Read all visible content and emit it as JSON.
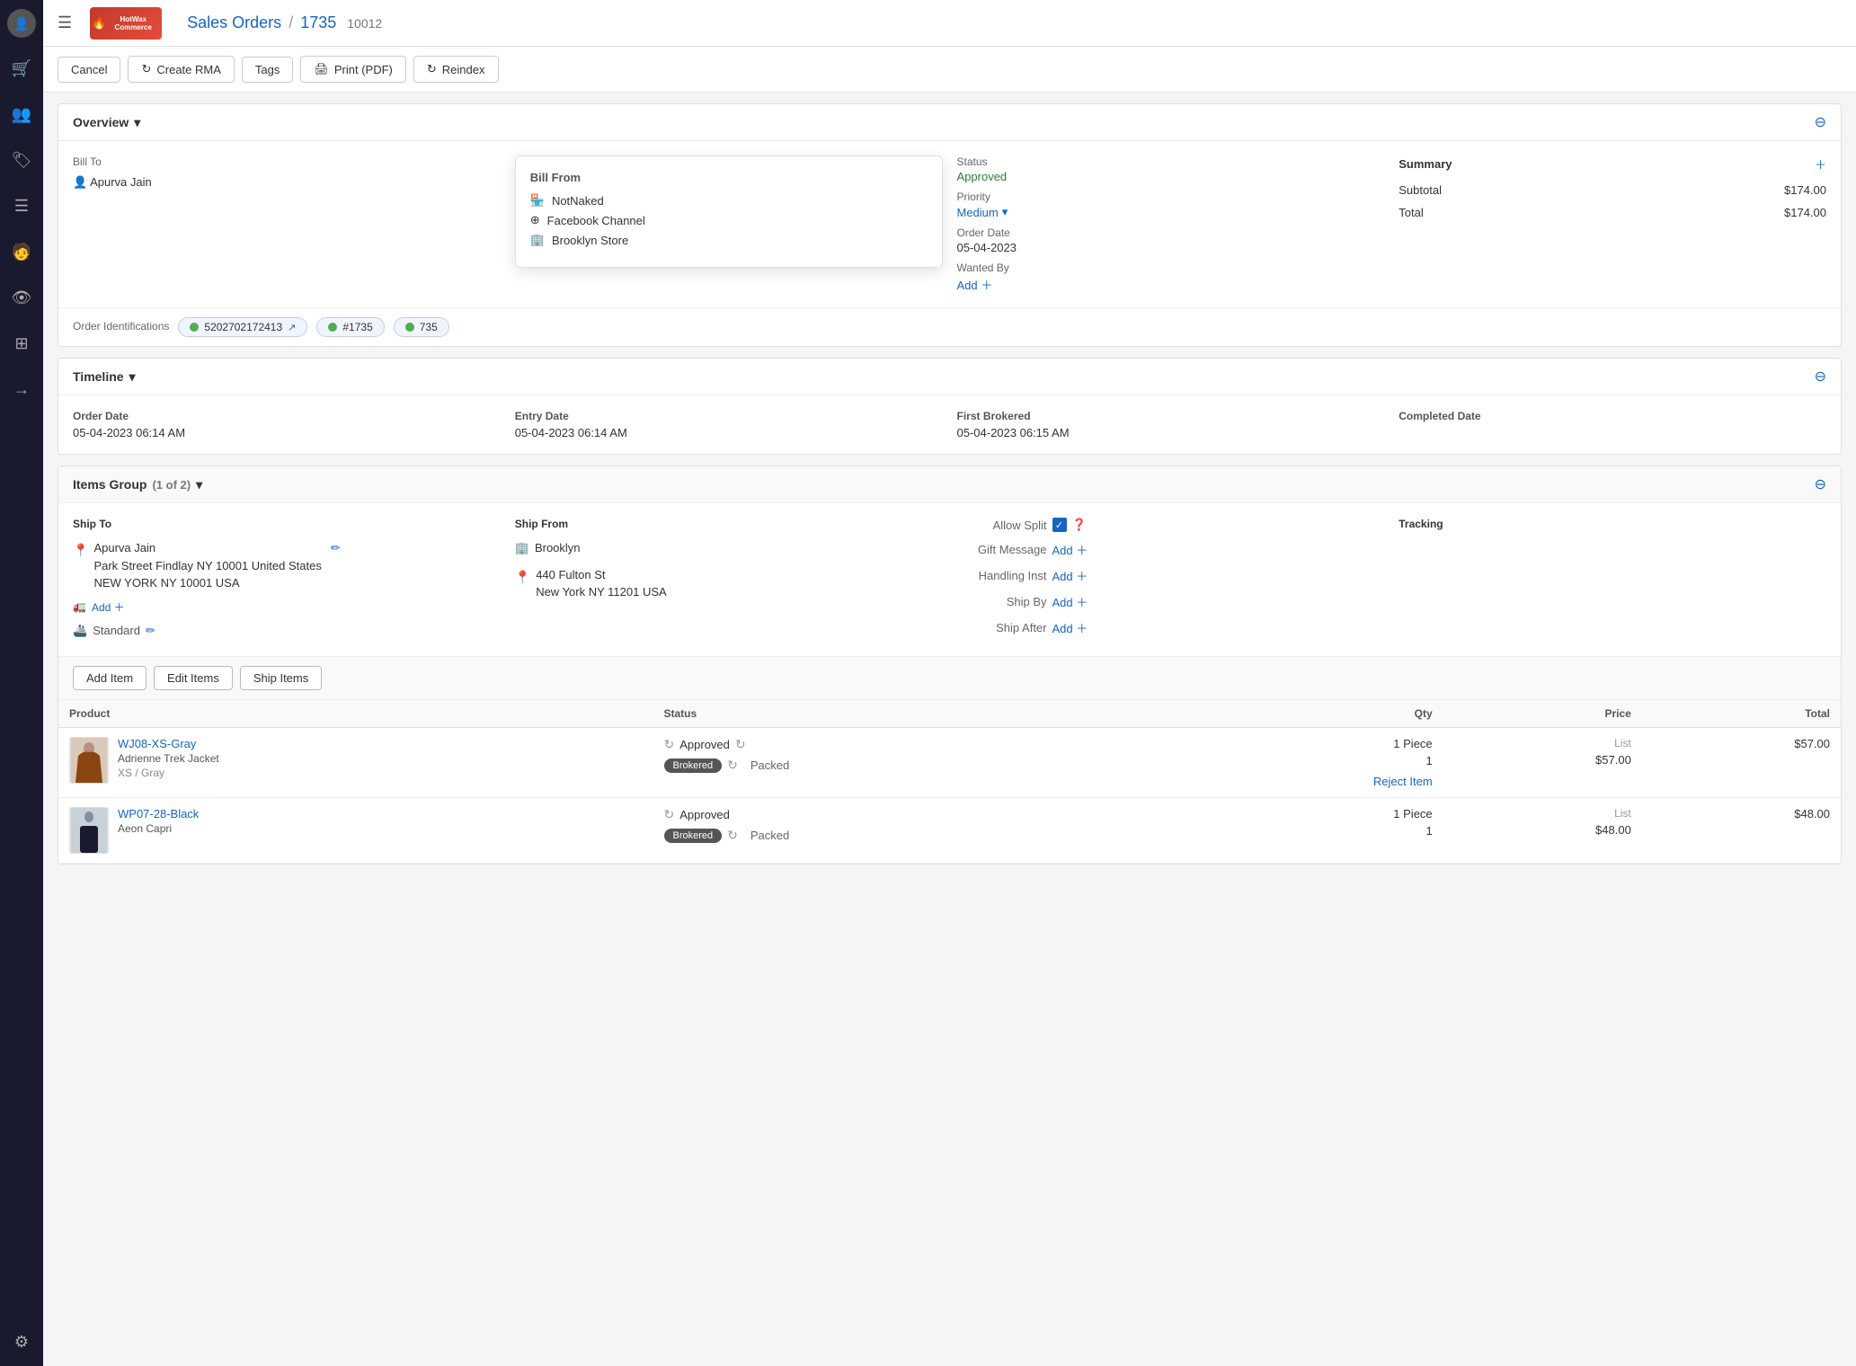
{
  "app": {
    "title": "HotWax Commerce",
    "hamburger_label": "☰"
  },
  "breadcrumb": {
    "section": "Sales Orders",
    "separator": "/",
    "order_number": "1735",
    "order_id": "10012"
  },
  "action_bar": {
    "cancel_label": "Cancel",
    "create_rma_label": "Create RMA",
    "tags_label": "Tags",
    "print_pdf_label": "Print (PDF)",
    "reindex_label": "Reindex"
  },
  "overview": {
    "title": "Overview",
    "bill_to": {
      "label": "Bill To",
      "name": "Apurva Jain"
    },
    "bill_from": {
      "label": "Bill From",
      "company": "NotNaked",
      "channel": "Facebook Channel",
      "store": "Brooklyn Store"
    },
    "status": {
      "label": "Status",
      "value": "Approved"
    },
    "priority": {
      "label": "Priority",
      "value": "Medium"
    },
    "order_date": {
      "label": "Order Date",
      "value": "05-04-2023"
    },
    "wanted_by": {
      "label": "Wanted By",
      "value": "Add"
    },
    "summary": {
      "label": "Summary",
      "subtotal_label": "Subtotal",
      "subtotal_value": "$174.00",
      "total_label": "Total",
      "total_value": "$174.00"
    },
    "order_identifications": {
      "label": "Order Identifications",
      "ids": [
        {
          "value": "5202702172413",
          "has_link": true
        },
        {
          "value": "#1735",
          "has_link": false
        },
        {
          "value": "735",
          "has_link": false
        }
      ]
    }
  },
  "timeline": {
    "title": "Timeline",
    "order_date_label": "Order Date",
    "order_date_value": "05-04-2023 06:14 AM",
    "entry_date_label": "Entry Date",
    "entry_date_value": "05-04-2023 06:14 AM",
    "first_brokered_label": "First Brokered",
    "first_brokered_value": "05-04-2023 06:15 AM",
    "completed_date_label": "Completed Date",
    "completed_date_value": ""
  },
  "items_group": {
    "title": "Items Group",
    "count": "(1 of 2)",
    "ship_to": {
      "label": "Ship To",
      "name": "Apurva Jain",
      "address1": "Park Street Findlay NY 10001 United States",
      "address2": "NEW YORK NY 10001 USA",
      "add_label": "Add",
      "method": "Standard"
    },
    "ship_from": {
      "label": "Ship From",
      "store": "Brooklyn",
      "address1": "440 Fulton St",
      "address2": "New York NY 11201 USA"
    },
    "allow_split": {
      "label": "Allow Split",
      "checked": true
    },
    "gift_message": {
      "label": "Gift Message",
      "value": "Add"
    },
    "handling_inst": {
      "label": "Handling Inst",
      "value": "Add"
    },
    "ship_by": {
      "label": "Ship By",
      "value": "Add"
    },
    "ship_after": {
      "label": "Ship After",
      "value": "Add"
    },
    "tracking": {
      "label": "Tracking"
    },
    "buttons": {
      "add_item": "Add Item",
      "edit_items": "Edit Items",
      "ship_items": "Ship Items"
    },
    "table": {
      "headers": {
        "product": "Product",
        "status": "Status",
        "qty": "Qty",
        "price": "Price",
        "total": "Total"
      },
      "rows": [
        {
          "product_id": "WJ08-XS-Gray",
          "product_name": "Adrienne Trek Jacket",
          "product_variant": "XS / Gray",
          "status": "Approved",
          "badge": "Brokered",
          "packed_label": "Packed",
          "qty_piece": "1 Piece",
          "qty_packed": "1",
          "price_label": "List",
          "price_value": "$57.00",
          "total": "$57.00",
          "reject_label": "Reject Item"
        },
        {
          "product_id": "WP07-28-Black",
          "product_name": "Aeon Capri",
          "product_variant": "",
          "status": "Approved",
          "badge": "Brokered",
          "packed_label": "Packed",
          "qty_piece": "1 Piece",
          "qty_packed": "1",
          "price_label": "List",
          "price_value": "$48.00",
          "total": "$48.00",
          "reject_label": ""
        }
      ]
    }
  },
  "sidebar": {
    "icons": [
      {
        "name": "user-icon",
        "glyph": "👤"
      },
      {
        "name": "cart-icon",
        "glyph": "🛒"
      },
      {
        "name": "people-icon",
        "glyph": "👥"
      },
      {
        "name": "tag-icon",
        "glyph": "🏷"
      },
      {
        "name": "list-icon",
        "glyph": "☰"
      },
      {
        "name": "person-icon",
        "glyph": "🧑"
      },
      {
        "name": "eye-icon",
        "glyph": "👁"
      },
      {
        "name": "layers-icon",
        "glyph": "⊞"
      },
      {
        "name": "arrow-icon",
        "glyph": "→"
      },
      {
        "name": "settings-icon",
        "glyph": "⚙"
      }
    ]
  }
}
